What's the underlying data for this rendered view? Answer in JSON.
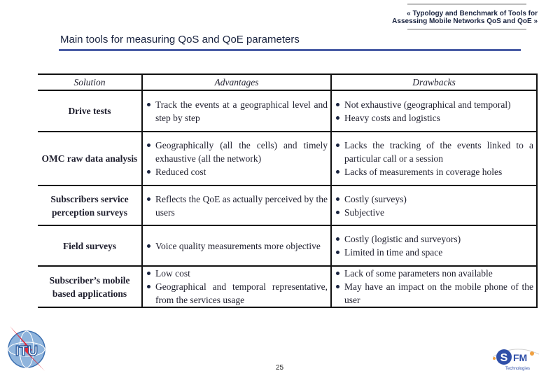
{
  "header": {
    "doc_title_line1": "« Typology and Benchmark of Tools for",
    "doc_title_line2": "Assessing Mobile Networks QoS and QoE »"
  },
  "slide": {
    "title": "Main tools for measuring QoS and QoE parameters",
    "accent_color": "#4a5da6",
    "page_number": "25"
  },
  "table": {
    "headers": [
      "Solution",
      "Advantages",
      "Drawbacks"
    ],
    "rows": [
      {
        "solution": "Drive tests",
        "advantages": [
          "Track the events at a geographical level and step by step"
        ],
        "drawbacks": [
          "Not exhaustive (geographical and temporal)",
          "Heavy costs and logistics"
        ]
      },
      {
        "solution": "OMC raw data analysis",
        "advantages": [
          "Geographically (all the cells) and timely exhaustive (all the network)",
          "Reduced cost"
        ],
        "drawbacks": [
          "Lacks the tracking of the events linked to a particular call or a session",
          "Lacks of measurements in coverage holes"
        ]
      },
      {
        "solution": "Subscribers service perception surveys",
        "advantages": [
          "Reflects the QoE as actually perceived by the users"
        ],
        "drawbacks": [
          "Costly (surveys)",
          "Subjective"
        ]
      },
      {
        "solution": "Field surveys",
        "advantages": [
          "Voice quality measurements more objective"
        ],
        "drawbacks": [
          "Costly (logistic and surveyors)",
          "Limited in time and space"
        ]
      },
      {
        "solution": "Subscriber’s mobile based applications",
        "advantages": [
          "Low cost",
          "Geographical and temporal representative, from the services usage"
        ],
        "drawbacks": [
          "Lack of some parameters non available",
          "May have an impact on the mobile phone of the user"
        ]
      }
    ]
  },
  "logos": {
    "left": {
      "icon": "itu-logo",
      "text": "ITU"
    },
    "right": {
      "icon": "sfm-logo",
      "text": "SFM",
      "subtext": "Technologies"
    }
  }
}
